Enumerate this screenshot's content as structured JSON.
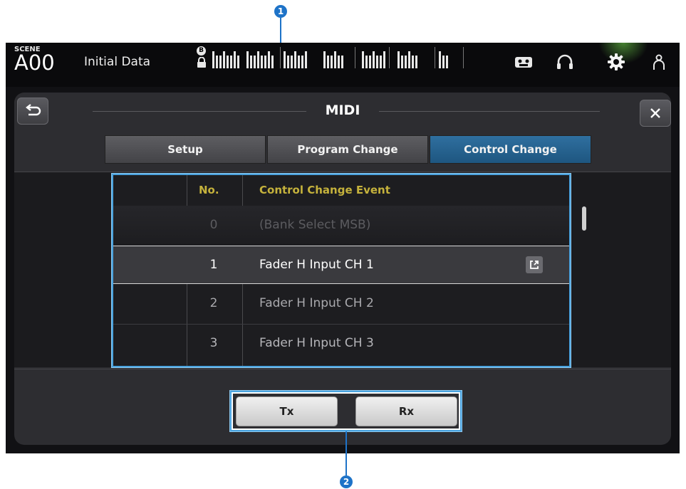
{
  "callouts": {
    "list_marker": "1",
    "buttons_marker": "2"
  },
  "status_bar": {
    "scene_label": "SCENE",
    "scene_number": "A00",
    "scene_name": "Initial Data",
    "lock_letter": "B",
    "icons": [
      "cassette-icon",
      "headphones-icon",
      "gear-icon",
      "user-icon"
    ]
  },
  "panel": {
    "title": "MIDI",
    "back_label": "back-icon",
    "close_label": "close-icon"
  },
  "tabs": [
    {
      "label": "Setup",
      "active": false
    },
    {
      "label": "Program Change",
      "active": false
    },
    {
      "label": "Control Change",
      "active": true
    }
  ],
  "list": {
    "header_no": "No.",
    "header_event": "Control Change Event",
    "rows": [
      {
        "no": "0",
        "event": "(Bank Select MSB)",
        "state": "disabled"
      },
      {
        "no": "1",
        "event": "Fader H Input CH 1",
        "state": "selected"
      },
      {
        "no": "2",
        "event": "Fader H Input CH 2",
        "state": "normal"
      },
      {
        "no": "3",
        "event": "Fader H Input CH 3",
        "state": "normal"
      }
    ]
  },
  "buttons": {
    "tx": "Tx",
    "rx": "Rx"
  },
  "colors": {
    "accent": "#1e5680",
    "header_text": "#c5b23c",
    "callout": "#1e73c8"
  }
}
